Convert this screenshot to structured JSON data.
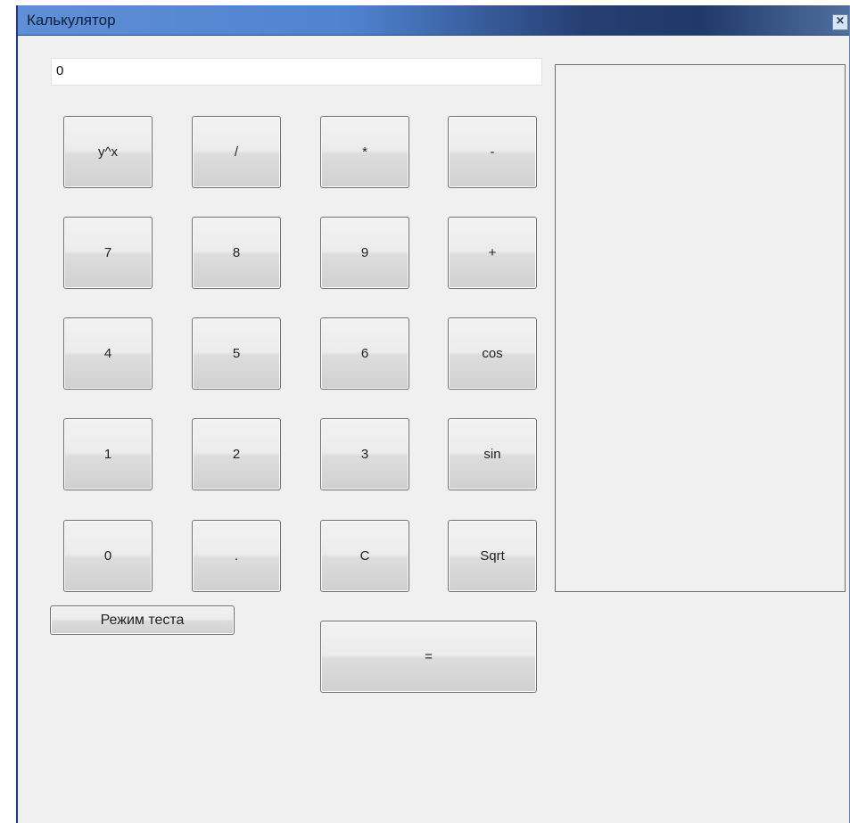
{
  "window": {
    "title": "Калькулятор",
    "close_label": "×"
  },
  "display": {
    "value": "0"
  },
  "buttons": {
    "row1": [
      "y^x",
      "/",
      "*",
      "-"
    ],
    "row2": [
      "7",
      "8",
      "9",
      "+"
    ],
    "row3": [
      "4",
      "5",
      "6",
      "cos"
    ],
    "row4": [
      "1",
      "2",
      "3",
      "sin"
    ],
    "row5": [
      "0",
      ".",
      "C",
      "Sqrt"
    ],
    "test_mode": "Режим теста",
    "equals": "="
  }
}
